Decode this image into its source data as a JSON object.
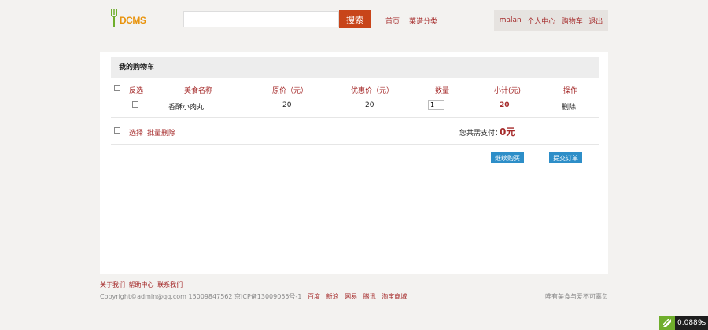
{
  "header": {
    "logo_text": "DCMS",
    "search": {
      "value": "",
      "placeholder": ""
    },
    "search_button": "搜索",
    "nav": [
      {
        "label": "首页"
      },
      {
        "label": "菜谱分类"
      }
    ],
    "user": [
      {
        "label": "malan"
      },
      {
        "label": "个人中心"
      },
      {
        "label": "购物车"
      },
      {
        "label": "退出"
      }
    ]
  },
  "cart": {
    "title": "我的购物车",
    "columns": {
      "invert": "反选",
      "name": "美食名称",
      "price": "原价（元）",
      "discount": "优惠价（元）",
      "qty": "数量",
      "subtotal": "小计(元)",
      "action": "操作"
    },
    "items": [
      {
        "name": "香酥小肉丸",
        "price": "20",
        "discount": "20",
        "qty": "1",
        "subtotal": "20",
        "action": "删除"
      }
    ],
    "select_label": "选择",
    "batch_delete": "批量删除",
    "total_label": "您共需支付：",
    "total_value": "0元",
    "continue_btn": "继续购买",
    "submit_btn": "提交订单"
  },
  "footer": {
    "links": [
      {
        "label": "关于我们"
      },
      {
        "label": "帮助中心"
      },
      {
        "label": "联系我们"
      }
    ],
    "copyright": "Copyright©admin@qq.com 15009847562 京ICP备13009055号-1",
    "partners": [
      {
        "label": "百度"
      },
      {
        "label": "新浪"
      },
      {
        "label": "网易"
      },
      {
        "label": "腾讯"
      },
      {
        "label": "淘宝商城"
      }
    ],
    "right_text": "唯有美食与爱不可辜负"
  },
  "timer": {
    "value": "0.0889s"
  },
  "colors": {
    "accent": "#a52a2a",
    "search_button": "#c8451a",
    "action_button": "#2d8ec8",
    "logo": "#e8930c"
  }
}
